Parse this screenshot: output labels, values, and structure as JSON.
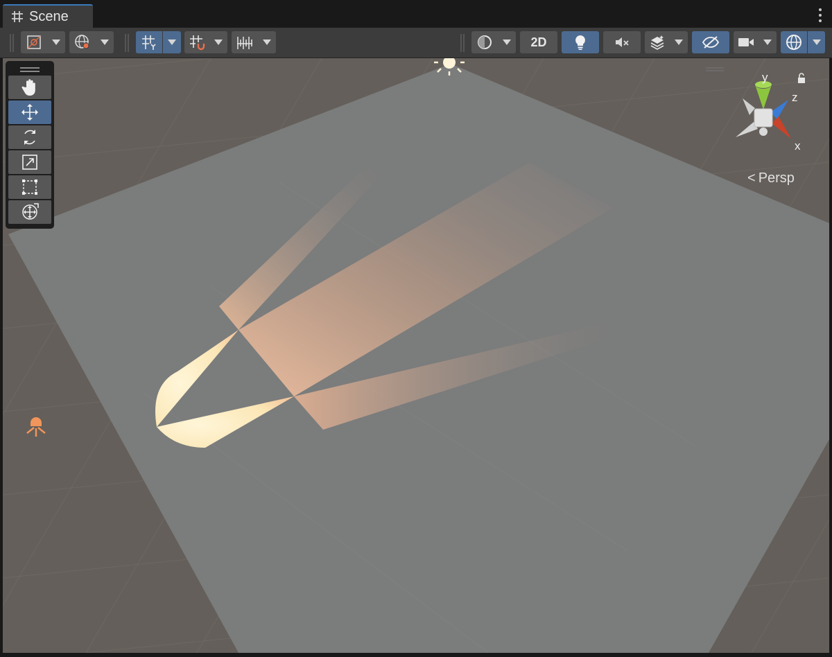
{
  "window": {
    "tab_label": "Scene",
    "tab_icon": "grid-hash-icon"
  },
  "toolbar": {
    "buttons": [
      {
        "name": "draw-mode",
        "icon": "shaded-draw-mode-icon",
        "has_dropdown": true
      },
      {
        "name": "global-local",
        "icon": "globe-pivot-icon",
        "has_dropdown": true
      },
      {
        "name": "grid-visibility",
        "icon": "grid-y-icon",
        "has_dropdown": true,
        "active": true
      },
      {
        "name": "grid-snapping",
        "icon": "grid-snap-magnet-icon",
        "has_dropdown": true
      },
      {
        "name": "increment-snapping",
        "icon": "ruler-increment-icon",
        "has_dropdown": true
      },
      {
        "name": "render-mode",
        "icon": "sphere-shading-icon",
        "has_dropdown": true
      },
      {
        "name": "2d-toggle",
        "label": "2D"
      },
      {
        "name": "lighting-toggle",
        "icon": "lightbulb-icon",
        "active": true
      },
      {
        "name": "audio-toggle",
        "icon": "audio-mute-icon"
      },
      {
        "name": "effects",
        "icon": "effects-stack-icon",
        "has_dropdown": true
      },
      {
        "name": "scene-visibility",
        "icon": "eye-slash-icon",
        "active": true
      },
      {
        "name": "camera-settings",
        "icon": "camera-icon",
        "has_dropdown": true
      },
      {
        "name": "gizmos",
        "icon": "gizmo-globe-icon",
        "has_dropdown": true,
        "active": true
      }
    ]
  },
  "tools": {
    "items": [
      {
        "name": "hand-tool",
        "icon": "hand-icon",
        "selected": false
      },
      {
        "name": "move-tool",
        "icon": "move-arrows-icon",
        "selected": true
      },
      {
        "name": "rotate-tool",
        "icon": "rotate-icon",
        "selected": false
      },
      {
        "name": "scale-tool",
        "icon": "scale-icon",
        "selected": false
      },
      {
        "name": "rect-tool",
        "icon": "rect-transform-icon",
        "selected": false
      },
      {
        "name": "transform-tool",
        "icon": "transform-combo-icon",
        "selected": false
      }
    ]
  },
  "gizmo": {
    "axis_x": "x",
    "axis_y": "y",
    "axis_z": "z",
    "projection_label": "Persp",
    "colors": {
      "x": "#c8432a",
      "y": "#8cc63e",
      "z": "#3a7bd5"
    }
  },
  "scene": {
    "plane_color": "#7b7c7c",
    "grid_background": "#645f5a",
    "light_color": "#f7c8a6",
    "icons": [
      "directional-light-icon",
      "spot-light-icon"
    ]
  }
}
